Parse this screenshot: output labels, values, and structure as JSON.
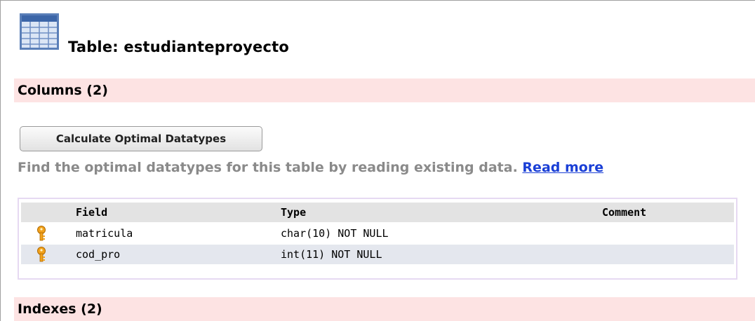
{
  "page": {
    "title": "Table: estudianteproyecto",
    "table_icon": "table-grid-icon"
  },
  "sections": {
    "columns": "Columns (2)",
    "indexes": "Indexes (2)"
  },
  "actions": {
    "calculate_label": "Calculate Optimal Datatypes",
    "hint_text": "Find the optimal datatypes for this table by reading existing data.",
    "read_more": "Read more"
  },
  "columns_table": {
    "headers": {
      "field": "Field",
      "type": "Type",
      "comment": "Comment"
    },
    "rows": [
      {
        "key_icon": "primary-key-icon",
        "field": "matricula",
        "type": "char(10) NOT NULL",
        "comment": ""
      },
      {
        "key_icon": "primary-key-icon",
        "field": "cod_pro",
        "type": "int(11) NOT NULL",
        "comment": ""
      }
    ]
  },
  "colors": {
    "section_bg": "#fde3e3",
    "link": "#1a3fd6",
    "hint": "#8a8a8a",
    "alt_row": "#e4e7ee"
  }
}
